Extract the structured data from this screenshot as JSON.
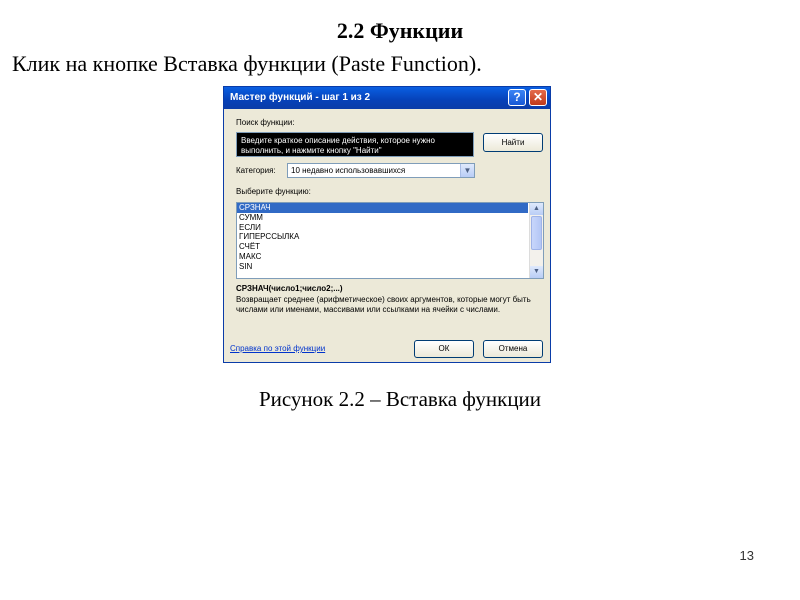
{
  "slide": {
    "title": "2.2 Функции",
    "subtitle": "Клик на кнопке Вставка функции (Paste Function).",
    "caption": "Рисунок 2.2 – Вставка функции",
    "page_number": "13"
  },
  "dialog": {
    "title": "Мастер функций - шаг 1 из 2",
    "help_symbol": "?",
    "close_symbol": "✕",
    "search_label": "Поиск функции:",
    "search_text": "Введите краткое описание действия, которое нужно выполнить, и нажмите кнопку \"Найти\"",
    "find_button": "Найти",
    "category_label": "Категория:",
    "category_value": "10 недавно использовавшихся",
    "select_label": "Выберите функцию:",
    "functions": [
      "СРЗНАЧ",
      "СУММ",
      "ЕСЛИ",
      "ГИПЕРССЫЛКА",
      "СЧЁТ",
      "МАКС",
      "SIN"
    ],
    "selected_index": 0,
    "signature": "СРЗНАЧ(число1;число2;...)",
    "description": "Возвращает среднее (арифметическое) своих аргументов, которые могут быть числами или именами, массивами или ссылками на ячейки с числами.",
    "help_link": "Справка по этой функции",
    "ok_button": "ОК",
    "cancel_button": "Отмена"
  },
  "colors": {
    "titlebar": "#0a3ca8",
    "selection": "#316ac5",
    "dialog_bg": "#ece9d8",
    "link": "#0033cc"
  },
  "icons": {
    "help": "help-icon",
    "close": "close-icon",
    "dropdown": "chevron-down-icon",
    "scroll_up": "arrow-up-icon",
    "scroll_down": "arrow-down-icon"
  }
}
